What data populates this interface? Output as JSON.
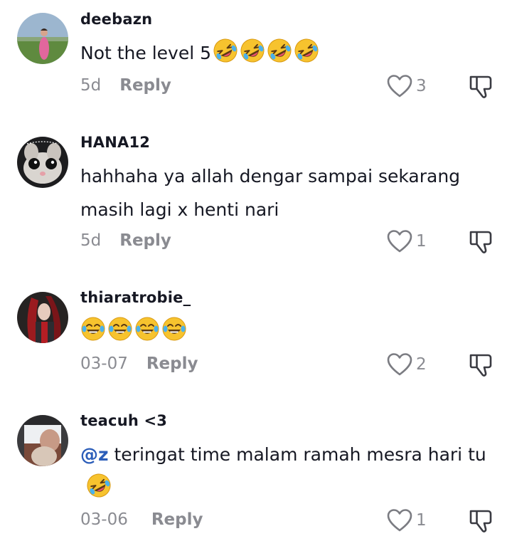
{
  "comments": [
    {
      "username": "deebazn",
      "text": "Not the level 5",
      "emojis": [
        "rofl-emoji",
        "rofl-emoji",
        "rofl-emoji",
        "rofl-emoji"
      ],
      "time": "5d",
      "reply_label": "Reply",
      "likes": "3"
    },
    {
      "username": "HANA12",
      "text": "hahhaha ya allah dengar sampai sekarang masih lagi x henti nari",
      "time": "5d",
      "reply_label": "Reply",
      "likes": "1"
    },
    {
      "username": "thiaratrobie_",
      "emojis": [
        "joy-emoji",
        "joy-emoji",
        "joy-emoji",
        "joy-emoji"
      ],
      "time": "03-07",
      "reply_label": "Reply",
      "likes": "2"
    },
    {
      "username": "teacuh <3",
      "mention": "@z",
      "text": " teringat time malam ramah mesra hari tu",
      "emojis": [
        "rofl-emoji"
      ],
      "time": "03-06",
      "reply_label": "Reply",
      "likes": "1"
    }
  ],
  "colors": {
    "text": "#161823",
    "secondary": "#8a8b91",
    "mention": "#2b5db9",
    "emoji": "#f7c32e"
  },
  "icons": {
    "like": "heart-outline-icon",
    "dislike": "thumbs-down-icon"
  }
}
